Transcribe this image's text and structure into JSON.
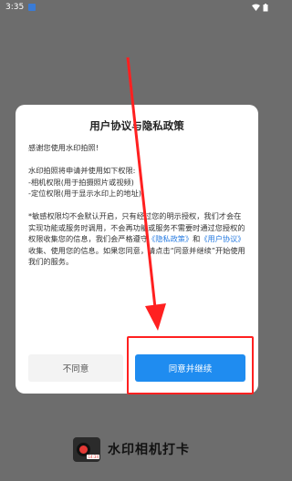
{
  "status_bar": {
    "time": "3:35",
    "signal_icon": "wifi-icon",
    "battery_icon": "battery-icon"
  },
  "dialog": {
    "title": "用户协议与隐私政策",
    "greeting": "感谢您使用水印拍照!",
    "permissions_intro": "水印拍照将申请并使用如下权限:",
    "permission_camera": "-相机权限(用于拍摄照片或视频)",
    "permission_location": "-定位权限(用于显示水印上的地址)",
    "notice_part1": "*敏感权限均不会默认开启，只有经过您的明示授权，我们才会在实现功能或服务时调用，不会再功能或服务不需要时通过您授权的权限收集您的信息，我们会严格遵守",
    "privacy_link": "《隐私政策》",
    "notice_and": "和",
    "user_agreement_link": "《用户协议》",
    "notice_part2": "收集、使用您的信息。如果您同意，请点击“同意并继续”开始使用我们的服务。",
    "disagree_label": "不同意",
    "agree_label": "同意并继续"
  },
  "brand": {
    "name": "水印相机打卡",
    "logo_stamp": "14:34",
    "logo_icon": "camera-logo-icon"
  },
  "colors": {
    "accent": "#1f8cf0",
    "link": "#2a7de1",
    "annotation": "#ff2020",
    "overlay": "#6d6d6d"
  }
}
